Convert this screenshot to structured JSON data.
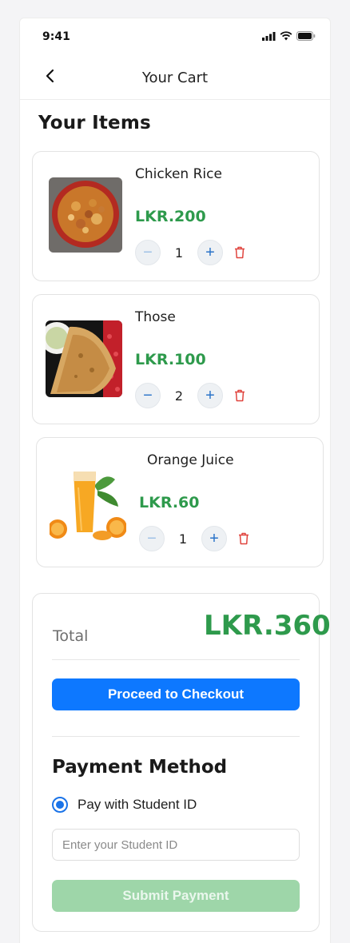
{
  "status_bar": {
    "time": "9:41"
  },
  "header": {
    "title": "Your Cart"
  },
  "section": {
    "title": "Your Items"
  },
  "cart": {
    "items": [
      {
        "name": "Chicken Rice",
        "price": "LKR.200",
        "quantity": "1"
      },
      {
        "name": "Those",
        "price": "LKR.100",
        "quantity": "2"
      },
      {
        "name": "Orange Juice",
        "price": "LKR.60",
        "quantity": "1"
      }
    ]
  },
  "summary": {
    "total_label": "Total",
    "total_value": "LKR.360",
    "checkout_label": "Proceed to Checkout"
  },
  "payment": {
    "title": "Payment Method",
    "option_label": "Pay with Student ID",
    "student_id_placeholder": "Enter your Student ID",
    "submit_label": "Submit Payment"
  },
  "colors": {
    "price_green": "#2e9a4c",
    "primary_blue": "#0d78ff",
    "disabled_green": "#9ed6a9",
    "delete_red": "#e0443e"
  },
  "icons": {
    "back": "chevron-left-icon",
    "delete": "trash-icon",
    "increase": "plus-icon",
    "decrease": "minus-icon"
  }
}
